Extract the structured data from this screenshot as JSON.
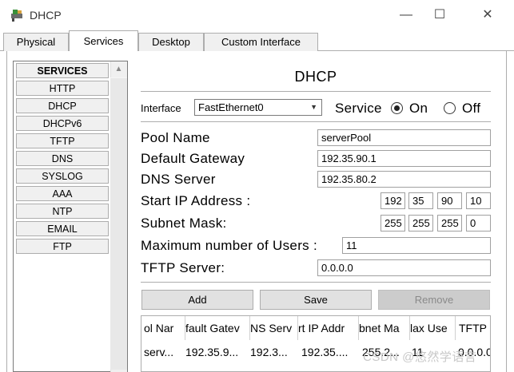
{
  "window": {
    "title": "DHCP",
    "minimize": "—",
    "maximize": "☐",
    "close": "✕"
  },
  "tabs": [
    "Physical",
    "Services",
    "Desktop",
    "Custom Interface"
  ],
  "sidebar": {
    "header": "SERVICES",
    "items": [
      "HTTP",
      "DHCP",
      "DHCPv6",
      "TFTP",
      "DNS",
      "SYSLOG",
      "AAA",
      "NTP",
      "EMAIL",
      "FTP"
    ]
  },
  "main": {
    "heading": "DHCP",
    "interface_label": "Interface",
    "interface_value": "FastEthernet0",
    "service_label": "Service",
    "on_label": "On",
    "off_label": "Off",
    "service_state": "On",
    "pool_name_label": "Pool Name",
    "pool_name_value": "serverPool",
    "gateway_label": "Default Gateway",
    "gateway_value": "192.35.90.1",
    "dns_label": "DNS Server",
    "dns_value": "192.35.80.2",
    "start_ip_label": "Start IP Address :",
    "start_ip": [
      "192",
      "35",
      "90",
      "10"
    ],
    "mask_label": "Subnet Mask:",
    "mask": [
      "255",
      "255",
      "255",
      "0"
    ],
    "max_users_label": "Maximum number of Users :",
    "max_users_value": "11",
    "tftp_label": "TFTP Server:",
    "tftp_value": "0.0.0.0",
    "add_button": "Add",
    "save_button": "Save",
    "remove_button": "Remove"
  },
  "table": {
    "headers": [
      "ol Nar",
      "fault Gatev",
      "NS Serv",
      "rt IP Addr",
      "bnet Ma",
      "lax Use",
      "TFTP"
    ],
    "rows": [
      [
        "serv...",
        "192.35.9...",
        "192.3...",
        "192.35....",
        "255.2...",
        "11",
        "0.0.0.0"
      ]
    ]
  },
  "watermark": "CSDN @悠然学语言"
}
